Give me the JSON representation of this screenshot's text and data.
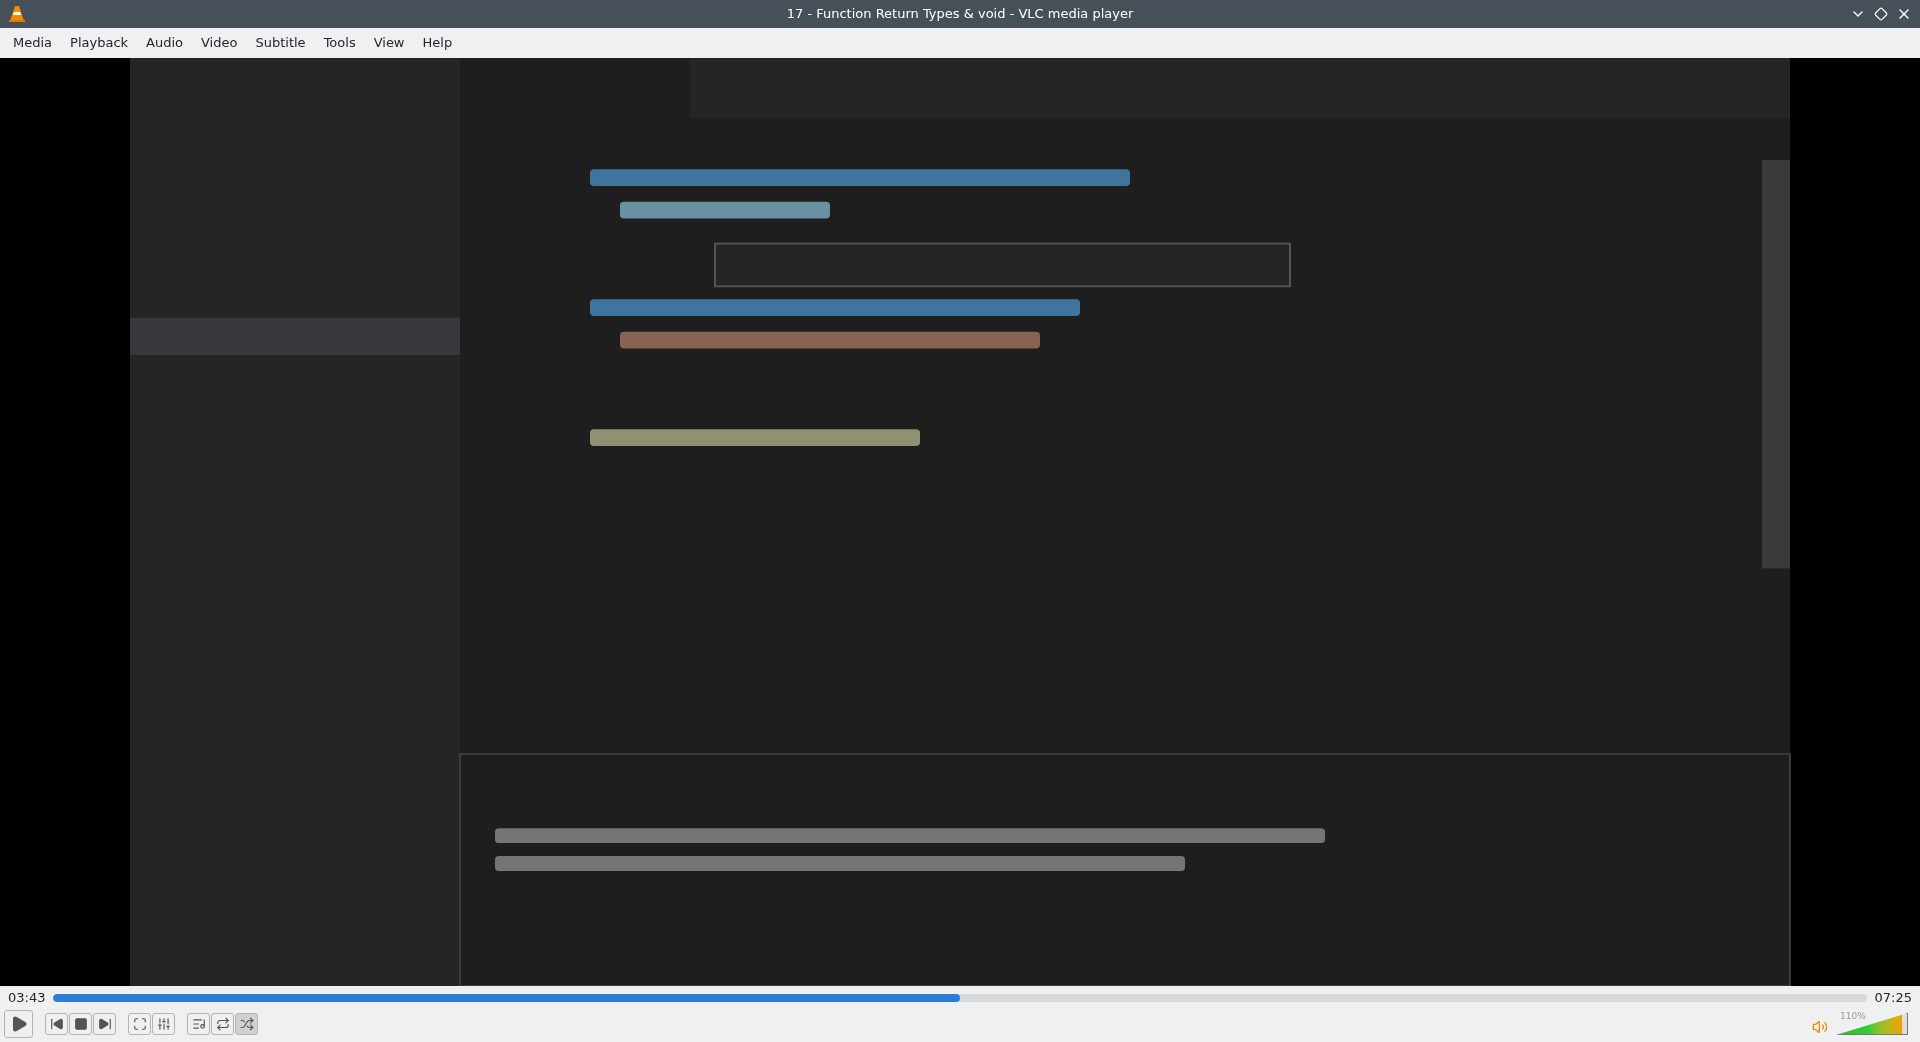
{
  "window": {
    "title": "17 - Function Return Types & void - VLC media player"
  },
  "menu": [
    "Media",
    "Playback",
    "Audio",
    "Video",
    "Subtitle",
    "Tools",
    "View",
    "Help"
  ],
  "video": {
    "kind": "picture"
  },
  "seek": {
    "elapsed": "03:43",
    "total": "07:25",
    "level": 0.5
  },
  "control_groups": [
    [
      {
        "kind": "play"
      }
    ],
    [
      {
        "kind": "previous"
      },
      {
        "kind": "stop"
      },
      {
        "kind": "next"
      }
    ],
    [
      {
        "kind": "fullscreen"
      },
      {
        "kind": "extended"
      }
    ],
    [
      {
        "kind": "playlist"
      },
      {
        "kind": "loop",
        "on": false
      },
      {
        "kind": "random",
        "on": true
      }
    ]
  ],
  "volume": {
    "reading": "110%",
    "level": 0.93
  }
}
